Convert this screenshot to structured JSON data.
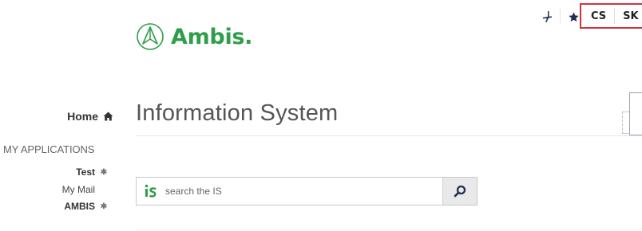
{
  "header": {
    "logo_text": "Ambis.",
    "icons": [
      "accessibility-icon",
      "star-icon"
    ],
    "languages": [
      "CS",
      "SK"
    ]
  },
  "nav": {
    "home_label": "Home",
    "section_label": "MY APPLICATIONS",
    "items": [
      {
        "label": "Test",
        "pinned": true,
        "bold": true
      },
      {
        "label": "My Mail",
        "pinned": false,
        "bold": false
      },
      {
        "label": "AMBIS",
        "pinned": true,
        "bold": true
      }
    ]
  },
  "main": {
    "title": "Information System",
    "search": {
      "logo": "iS",
      "placeholder": "search the IS"
    }
  },
  "colors": {
    "brand_green": "#2f9e4b",
    "highlight_red": "#d3323c",
    "icon_navy": "#1f2d52"
  }
}
